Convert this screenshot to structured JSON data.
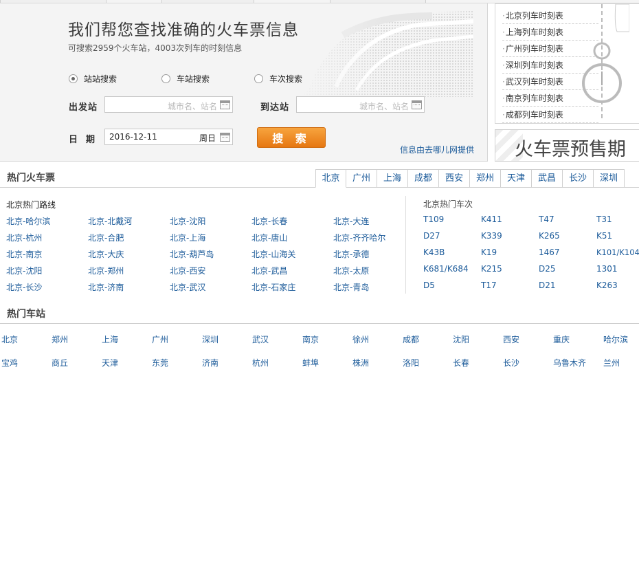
{
  "search": {
    "title": "我们帮您查找准确的火车票信息",
    "subtitle": "可搜索2959个火车站，4003次列车的时刻信息",
    "modes": [
      {
        "label": "站站搜索",
        "selected": true
      },
      {
        "label": "车站搜索",
        "selected": false
      },
      {
        "label": "车次搜索",
        "selected": false
      }
    ],
    "from_label": "出发站",
    "to_label": "到达站",
    "from_placeholder": "城市名、站名",
    "to_placeholder": "城市名、站名",
    "date_label": "日  期",
    "date_value": "2016-12-11",
    "weekday": "周日",
    "search_button": "搜 索",
    "provider": "信息由去哪儿网提供"
  },
  "timetables": [
    "北京列车时刻表",
    "上海列车时刻表",
    "广州列车时刻表",
    "深圳列车时刻表",
    "武汉列车时刻表",
    "南京列车时刻表",
    "成都列车时刻表"
  ],
  "presale": "火车票预售期",
  "hot_tickets": {
    "title": "热门火车票",
    "city_tabs": [
      "北京",
      "广州",
      "上海",
      "成都",
      "西安",
      "郑州",
      "天津",
      "武昌",
      "长沙",
      "深圳"
    ],
    "routes_title": "北京热门路线",
    "routes": [
      [
        "北京-哈尔滨",
        "北京-北戴河",
        "北京-沈阳",
        "北京-长春",
        "北京-大连"
      ],
      [
        "北京-杭州",
        "北京-合肥",
        "北京-上海",
        "北京-唐山",
        "北京-齐齐哈尔"
      ],
      [
        "北京-南京",
        "北京-大庆",
        "北京-葫芦岛",
        "北京-山海关",
        "北京-承德"
      ],
      [
        "北京-沈阳",
        "北京-郑州",
        "北京-西安",
        "北京-武昌",
        "北京-太原"
      ],
      [
        "北京-长沙",
        "北京-济南",
        "北京-武汉",
        "北京-石家庄",
        "北京-青岛"
      ]
    ],
    "trains_title": "北京热门车次",
    "trains": [
      [
        "T109",
        "K411",
        "T47",
        "T31"
      ],
      [
        "D27",
        "K339",
        "K265",
        "K51"
      ],
      [
        "K43B",
        "K19",
        "1467",
        "K101/K104"
      ],
      [
        "K681/K684",
        "K215",
        "D25",
        "1301"
      ],
      [
        "D5",
        "T17",
        "D21",
        "K263"
      ]
    ]
  },
  "hot_stations": {
    "title": "热门车站",
    "rows": [
      [
        "北京",
        "郑州",
        "上海",
        "广州",
        "深圳",
        "武汉",
        "南京",
        "徐州",
        "成都",
        "沈阳",
        "西安",
        "重庆",
        "哈尔滨"
      ],
      [
        "宝鸡",
        "商丘",
        "天津",
        "东莞",
        "济南",
        "杭州",
        "蚌埠",
        "株洲",
        "洛阳",
        "长春",
        "长沙",
        "乌鲁木齐",
        "兰州"
      ]
    ]
  }
}
